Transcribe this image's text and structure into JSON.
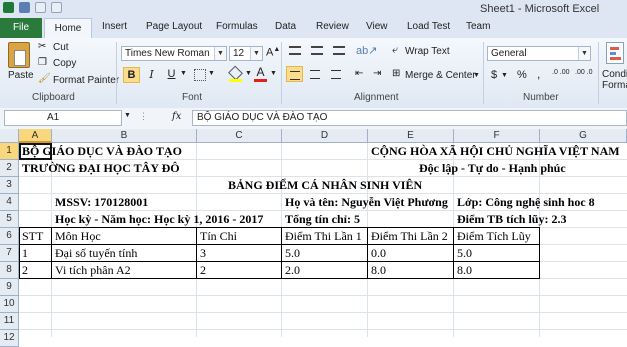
{
  "window": {
    "title": "Sheet1 - Microsoft Excel"
  },
  "tabs": [
    "File",
    "Home",
    "Insert",
    "Page Layout",
    "Formulas",
    "Data",
    "Review",
    "View",
    "Load Test",
    "Team"
  ],
  "ribbon": {
    "clipboard": {
      "paste": "Paste",
      "cut": "Cut",
      "copy": "Copy",
      "format_painter": "Format Painter",
      "label": "Clipboard"
    },
    "font": {
      "name": "Times New Roman",
      "size": "12",
      "bold": "B",
      "italic": "I",
      "underline": "U",
      "color_glyph": "A",
      "label": "Font"
    },
    "alignment": {
      "wrap_text": "Wrap Text",
      "merge_center": "Merge & Center",
      "label": "Alignment"
    },
    "number": {
      "format": "General",
      "currency": "$",
      "percent": "%",
      "comma": ",",
      "dec_inc": ".0 .00",
      "dec_dec": ".00 .0",
      "label": "Number"
    },
    "styles": {
      "conditional_1": "Conditi",
      "conditional_2": "Formatt"
    }
  },
  "formula_bar": {
    "name_box": "A1",
    "fx": "fx",
    "content": "BỘ GIÁO DỤC VÀ ĐÀO TẠO"
  },
  "columns": [
    "A",
    "B",
    "C",
    "D",
    "E",
    "F",
    "G"
  ],
  "rows": [
    "1",
    "2",
    "3",
    "4",
    "5",
    "6",
    "7",
    "8",
    "9",
    "10",
    "11",
    "12"
  ],
  "sheet": {
    "header_left_1": "BỘ GIÁO DỤC VÀ ĐÀO TẠO",
    "header_left_2": "TRƯỜNG ĐẠI HỌC TÂY ĐÔ",
    "header_right_1": "CỘNG HÒA XÃ HỘI CHỦ NGHĨA VIỆT NAM",
    "header_right_2": "Độc lập - Tự do - Hạnh phúc",
    "title": "BẢNG ĐIỂM CÁ NHÂN SINH VIÊN",
    "mssv": "MSSV: 170128001",
    "name": "Họ và tên: Nguyễn Việt Phương",
    "class": "Lớp: Công nghệ sinh hoc 8",
    "term": "Học kỳ - Năm học: Học kỳ 1, 2016 - 2017",
    "credits": "Tổng tín chỉ: 5",
    "gpa": "Điểm TB tích lũy: 2.3",
    "table_headers": [
      "STT",
      "Môn Học",
      "Tín Chỉ",
      "Điểm Thi Lần 1",
      "Điểm Thi Lần 2",
      "Điểm Tích Lũy"
    ],
    "table_rows": [
      [
        "1",
        "Đại số tuyến tính",
        "3",
        "5.0",
        "0.0",
        "5.0"
      ],
      [
        "2",
        "Vi tích phân A2",
        "2",
        "2.0",
        "8.0",
        "8.0"
      ]
    ]
  },
  "colors": {
    "file_tab": "#2a7a3c",
    "selection_header": "#f8d77d",
    "ribbon_bg": "#dfe8f3"
  }
}
